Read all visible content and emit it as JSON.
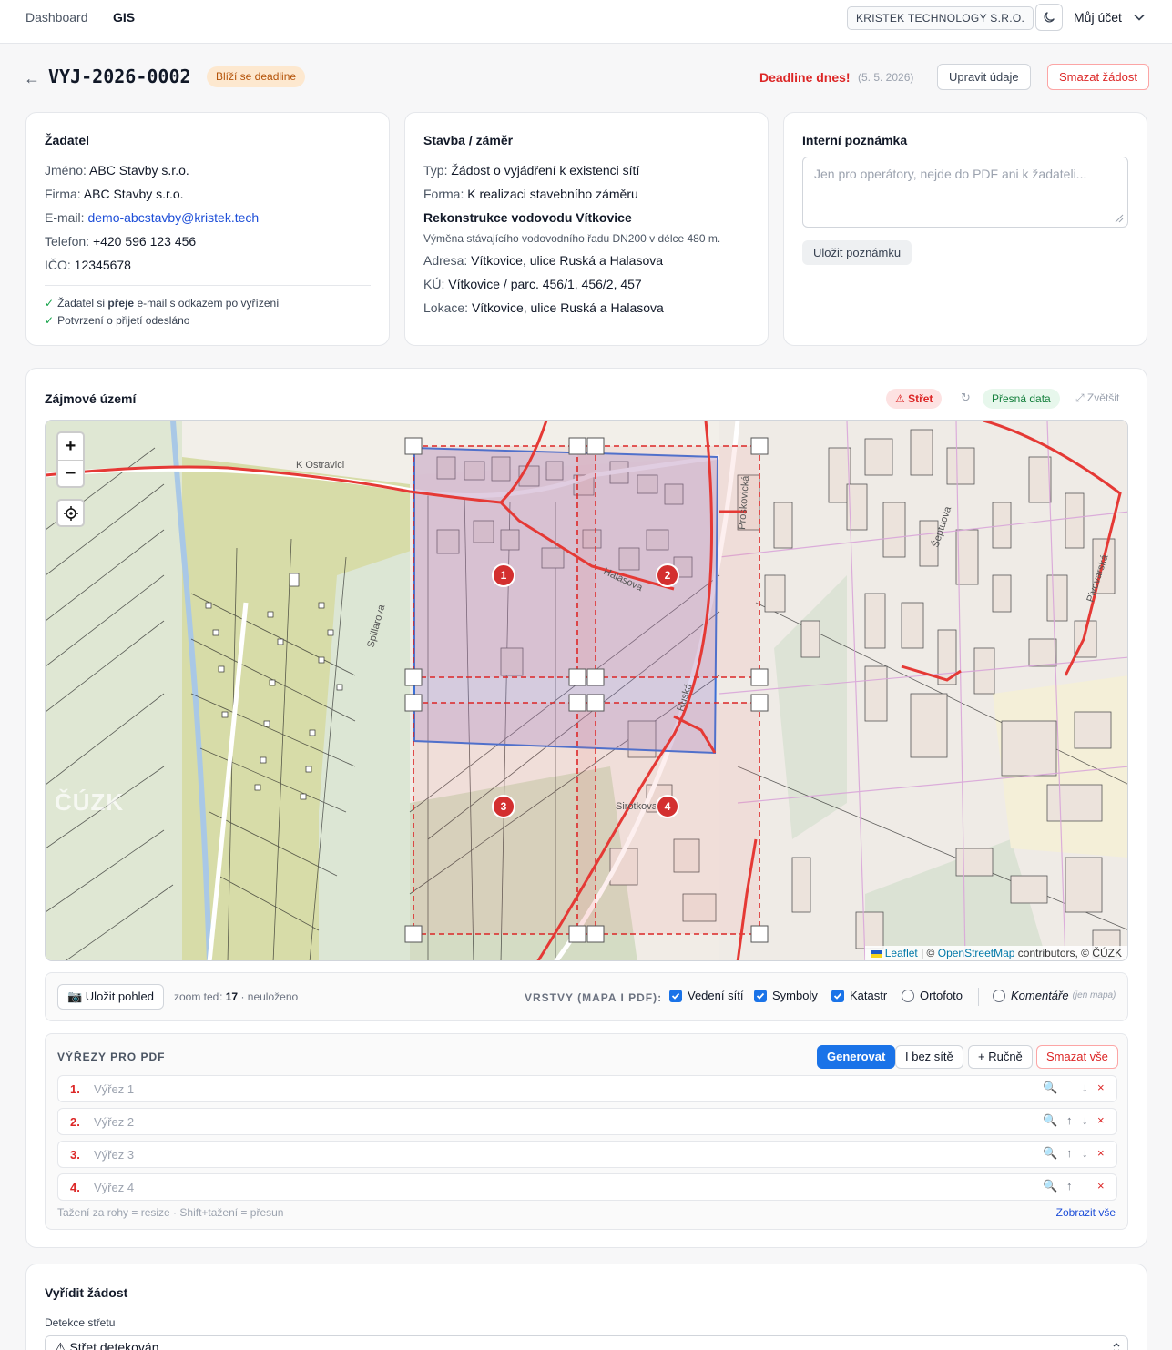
{
  "nav": {
    "links": [
      "Dashboard",
      "GIS"
    ],
    "company": "KRISTEK TECHNOLOGY S.R.O.",
    "account": "Můj účet"
  },
  "header": {
    "back": "←",
    "title": "VYJ-2026-0002",
    "status_badge": "Blíží se deadline",
    "deadline_label": "Deadline dnes!",
    "deadline_date": "(5. 5. 2026)",
    "edit_button": "Upravit údaje",
    "delete_button": "Smazat žádost"
  },
  "applicant": {
    "title": "Žadatel",
    "fields": [
      {
        "k": "Jméno:",
        "v": "ABC Stavby s.r.o."
      },
      {
        "k": "Firma:",
        "v": "ABC Stavby s.r.o."
      },
      {
        "k": "E-mail:",
        "v": "demo-abcstavby@kristek.tech"
      },
      {
        "k": "Telefon:",
        "v": "+420 596 123 456"
      },
      {
        "k": "IČO:",
        "v": "12345678"
      }
    ],
    "notice_1_a": "Žadatel si ",
    "notice_1_b": "přeje",
    "notice_1_c": " e-mail s odkazem po vyřízení",
    "notice_2": "Potvrzení o přijetí odesláno"
  },
  "project": {
    "title": "Stavba / záměr",
    "type": {
      "k": "Typ:",
      "v": "Žádost o vyjádření k existenci sítí"
    },
    "form": {
      "k": "Forma:",
      "v": "K realizaci stavebního záměru"
    },
    "name": "Rekonstrukce vodovodu Vítkovice",
    "description": "Výměna stávajícího vodovodního řadu DN200 v délce 480 m.",
    "address": {
      "k": "Adresa:",
      "v": "Vítkovice, ulice Ruská a Halasova"
    },
    "ku": {
      "k": "KÚ:",
      "v": "Vítkovice / parc. 456/1, 456/2, 457"
    },
    "location": {
      "k": "Lokace:",
      "v": "Vítkovice, ulice Ruská a Halasova"
    }
  },
  "internal_note": {
    "title": "Interní poznámka",
    "placeholder": "Jen pro operátory, nejde do PDF ani k žadateli...",
    "save_button": "Uložit poznámku"
  },
  "map_section": {
    "title": "Zájmové území",
    "conflict_pill": "⚠ Střet",
    "refresh_icon": "↻",
    "precise_pill": "Přesná data",
    "enlarge": "⤢ Zvětšit",
    "zoom_in": "+",
    "zoom_out": "−",
    "markers": [
      "1",
      "2",
      "3",
      "4"
    ],
    "street_labels": [
      "K Ostravici",
      "Halasova",
      "Ruská",
      "Proskovická",
      "Spillarova",
      "Sirotkova",
      "Šeptuova",
      "Pivovarská"
    ],
    "watermark": "ČÚZK",
    "attribution_leaflet": "Leaflet",
    "attribution_sep": " | © ",
    "attribution_osm": "OpenStreetMap",
    "attribution_rest": " contributors, © ČÚZK",
    "colors": {
      "network_red": "#e53935",
      "query_blue": "#3b6fd6",
      "cutout_red": "#dc2626",
      "cadastre_pink": "#d9a6d9",
      "field_green": "#d6dca8"
    }
  },
  "map_toolbar": {
    "save_view": "📷 Uložit pohled",
    "zoom_label": "zoom teď:",
    "zoom_value": "17",
    "unsaved": "· neuloženo",
    "layers_title": "VRSTVY (MAPA I PDF):",
    "layers": [
      {
        "label": "Vedení sítí",
        "checked": true
      },
      {
        "label": "Symboly",
        "checked": true
      },
      {
        "label": "Katastr",
        "checked": true
      },
      {
        "label": "Ortofoto",
        "checked": false
      },
      {
        "label": "Komentáře",
        "note": "(jen mapa)",
        "checked": false
      }
    ]
  },
  "cutouts": {
    "title": "VÝŘEZY PRO PDF",
    "generate": "Generovat",
    "no_network": "I bez sítě",
    "manual": "+ Ručně",
    "delete_all": "Smazat vše",
    "items": [
      {
        "num": "1.",
        "name": "Výřez 1"
      },
      {
        "num": "2.",
        "name": "Výřez 2"
      },
      {
        "num": "3.",
        "name": "Výřez 3"
      },
      {
        "num": "4.",
        "name": "Výřez 4"
      }
    ],
    "hint": "Tažení za rohy = resize · Shift+tažení = přesun",
    "show_all": "Zobrazit vše"
  },
  "resolve": {
    "title": "Vyřídit žádost",
    "detection_label": "Detekce střetu",
    "detection_value": "⚠ Střet detekován"
  }
}
